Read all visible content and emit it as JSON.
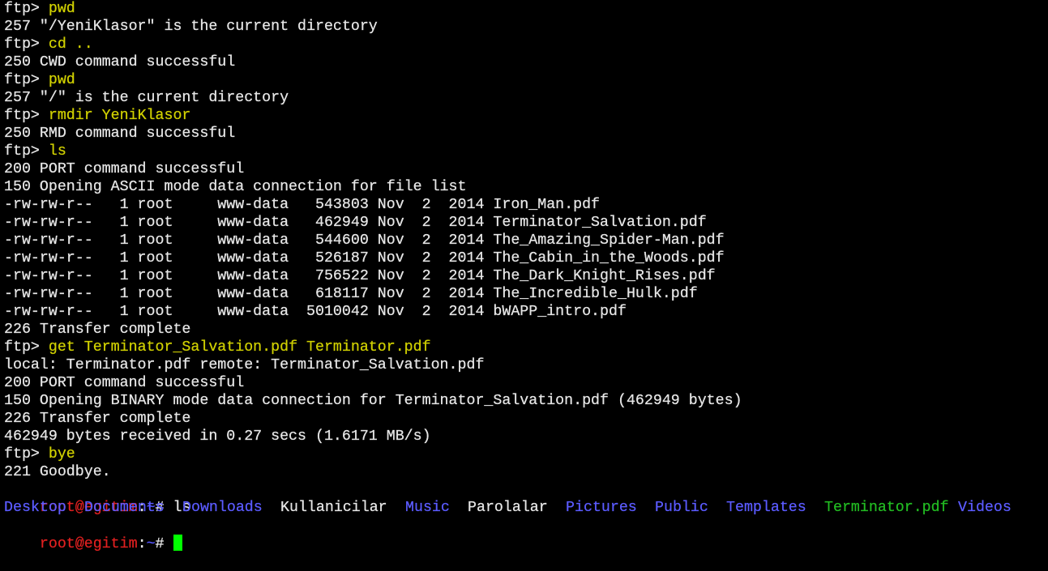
{
  "colors": {
    "background": "#000000",
    "output": "#e6e6e6",
    "command": "#d0d000",
    "prompt_user": "#e02020",
    "prompt_path": "#5555ff",
    "directory": "#5b5bff",
    "pdf_file": "#22bb22",
    "cursor": "#00ff00"
  },
  "ftp_prompt": "ftp> ",
  "lines": [
    {
      "kind": "cmd",
      "text": "pwd"
    },
    {
      "kind": "out",
      "text": "257 \"/YeniKlasor\" is the current directory"
    },
    {
      "kind": "cmd",
      "text": "cd .."
    },
    {
      "kind": "out",
      "text": "250 CWD command successful"
    },
    {
      "kind": "cmd",
      "text": "pwd"
    },
    {
      "kind": "out",
      "text": "257 \"/\" is the current directory"
    },
    {
      "kind": "cmd",
      "text": "rmdir YeniKlasor"
    },
    {
      "kind": "out",
      "text": "250 RMD command successful"
    },
    {
      "kind": "cmd",
      "text": "ls"
    },
    {
      "kind": "out",
      "text": "200 PORT command successful"
    },
    {
      "kind": "out",
      "text": "150 Opening ASCII mode data connection for file list"
    },
    {
      "kind": "out",
      "text": "-rw-rw-r--   1 root     www-data   543803 Nov  2  2014 Iron_Man.pdf"
    },
    {
      "kind": "out",
      "text": "-rw-rw-r--   1 root     www-data   462949 Nov  2  2014 Terminator_Salvation.pdf"
    },
    {
      "kind": "out",
      "text": "-rw-rw-r--   1 root     www-data   544600 Nov  2  2014 The_Amazing_Spider-Man.pdf"
    },
    {
      "kind": "out",
      "text": "-rw-rw-r--   1 root     www-data   526187 Nov  2  2014 The_Cabin_in_the_Woods.pdf"
    },
    {
      "kind": "out",
      "text": "-rw-rw-r--   1 root     www-data   756522 Nov  2  2014 The_Dark_Knight_Rises.pdf"
    },
    {
      "kind": "out",
      "text": "-rw-rw-r--   1 root     www-data   618117 Nov  2  2014 The_Incredible_Hulk.pdf"
    },
    {
      "kind": "out",
      "text": "-rw-rw-r--   1 root     www-data  5010042 Nov  2  2014 bWAPP_intro.pdf"
    },
    {
      "kind": "out",
      "text": "226 Transfer complete"
    },
    {
      "kind": "cmd",
      "text": "get Terminator_Salvation.pdf Terminator.pdf"
    },
    {
      "kind": "out",
      "text": "local: Terminator.pdf remote: Terminator_Salvation.pdf"
    },
    {
      "kind": "out",
      "text": "200 PORT command successful"
    },
    {
      "kind": "out",
      "text": "150 Opening BINARY mode data connection for Terminator_Salvation.pdf (462949 bytes)"
    },
    {
      "kind": "out",
      "text": "226 Transfer complete"
    },
    {
      "kind": "out",
      "text": "462949 bytes received in 0.27 secs (1.6171 MB/s)"
    },
    {
      "kind": "cmd",
      "text": "bye"
    },
    {
      "kind": "out",
      "text": "221 Goodbye."
    }
  ],
  "shell": {
    "user_host": "root@egitim",
    "separator": ":",
    "path": "~",
    "symbol": "# ",
    "ls_command": "ls"
  },
  "ls_entries": [
    {
      "name": "Desktop",
      "type": "dir"
    },
    {
      "name": "Documents",
      "type": "dir"
    },
    {
      "name": "Downloads",
      "type": "dir"
    },
    {
      "name": "Kullanicilar",
      "type": "file"
    },
    {
      "name": "Music",
      "type": "dir"
    },
    {
      "name": "Parolalar",
      "type": "file"
    },
    {
      "name": "Pictures",
      "type": "dir"
    },
    {
      "name": "Public",
      "type": "dir"
    },
    {
      "name": "Templates",
      "type": "dir"
    },
    {
      "name": "Terminator.pdf",
      "type": "exe"
    },
    {
      "name": "Videos",
      "type": "dir"
    }
  ]
}
